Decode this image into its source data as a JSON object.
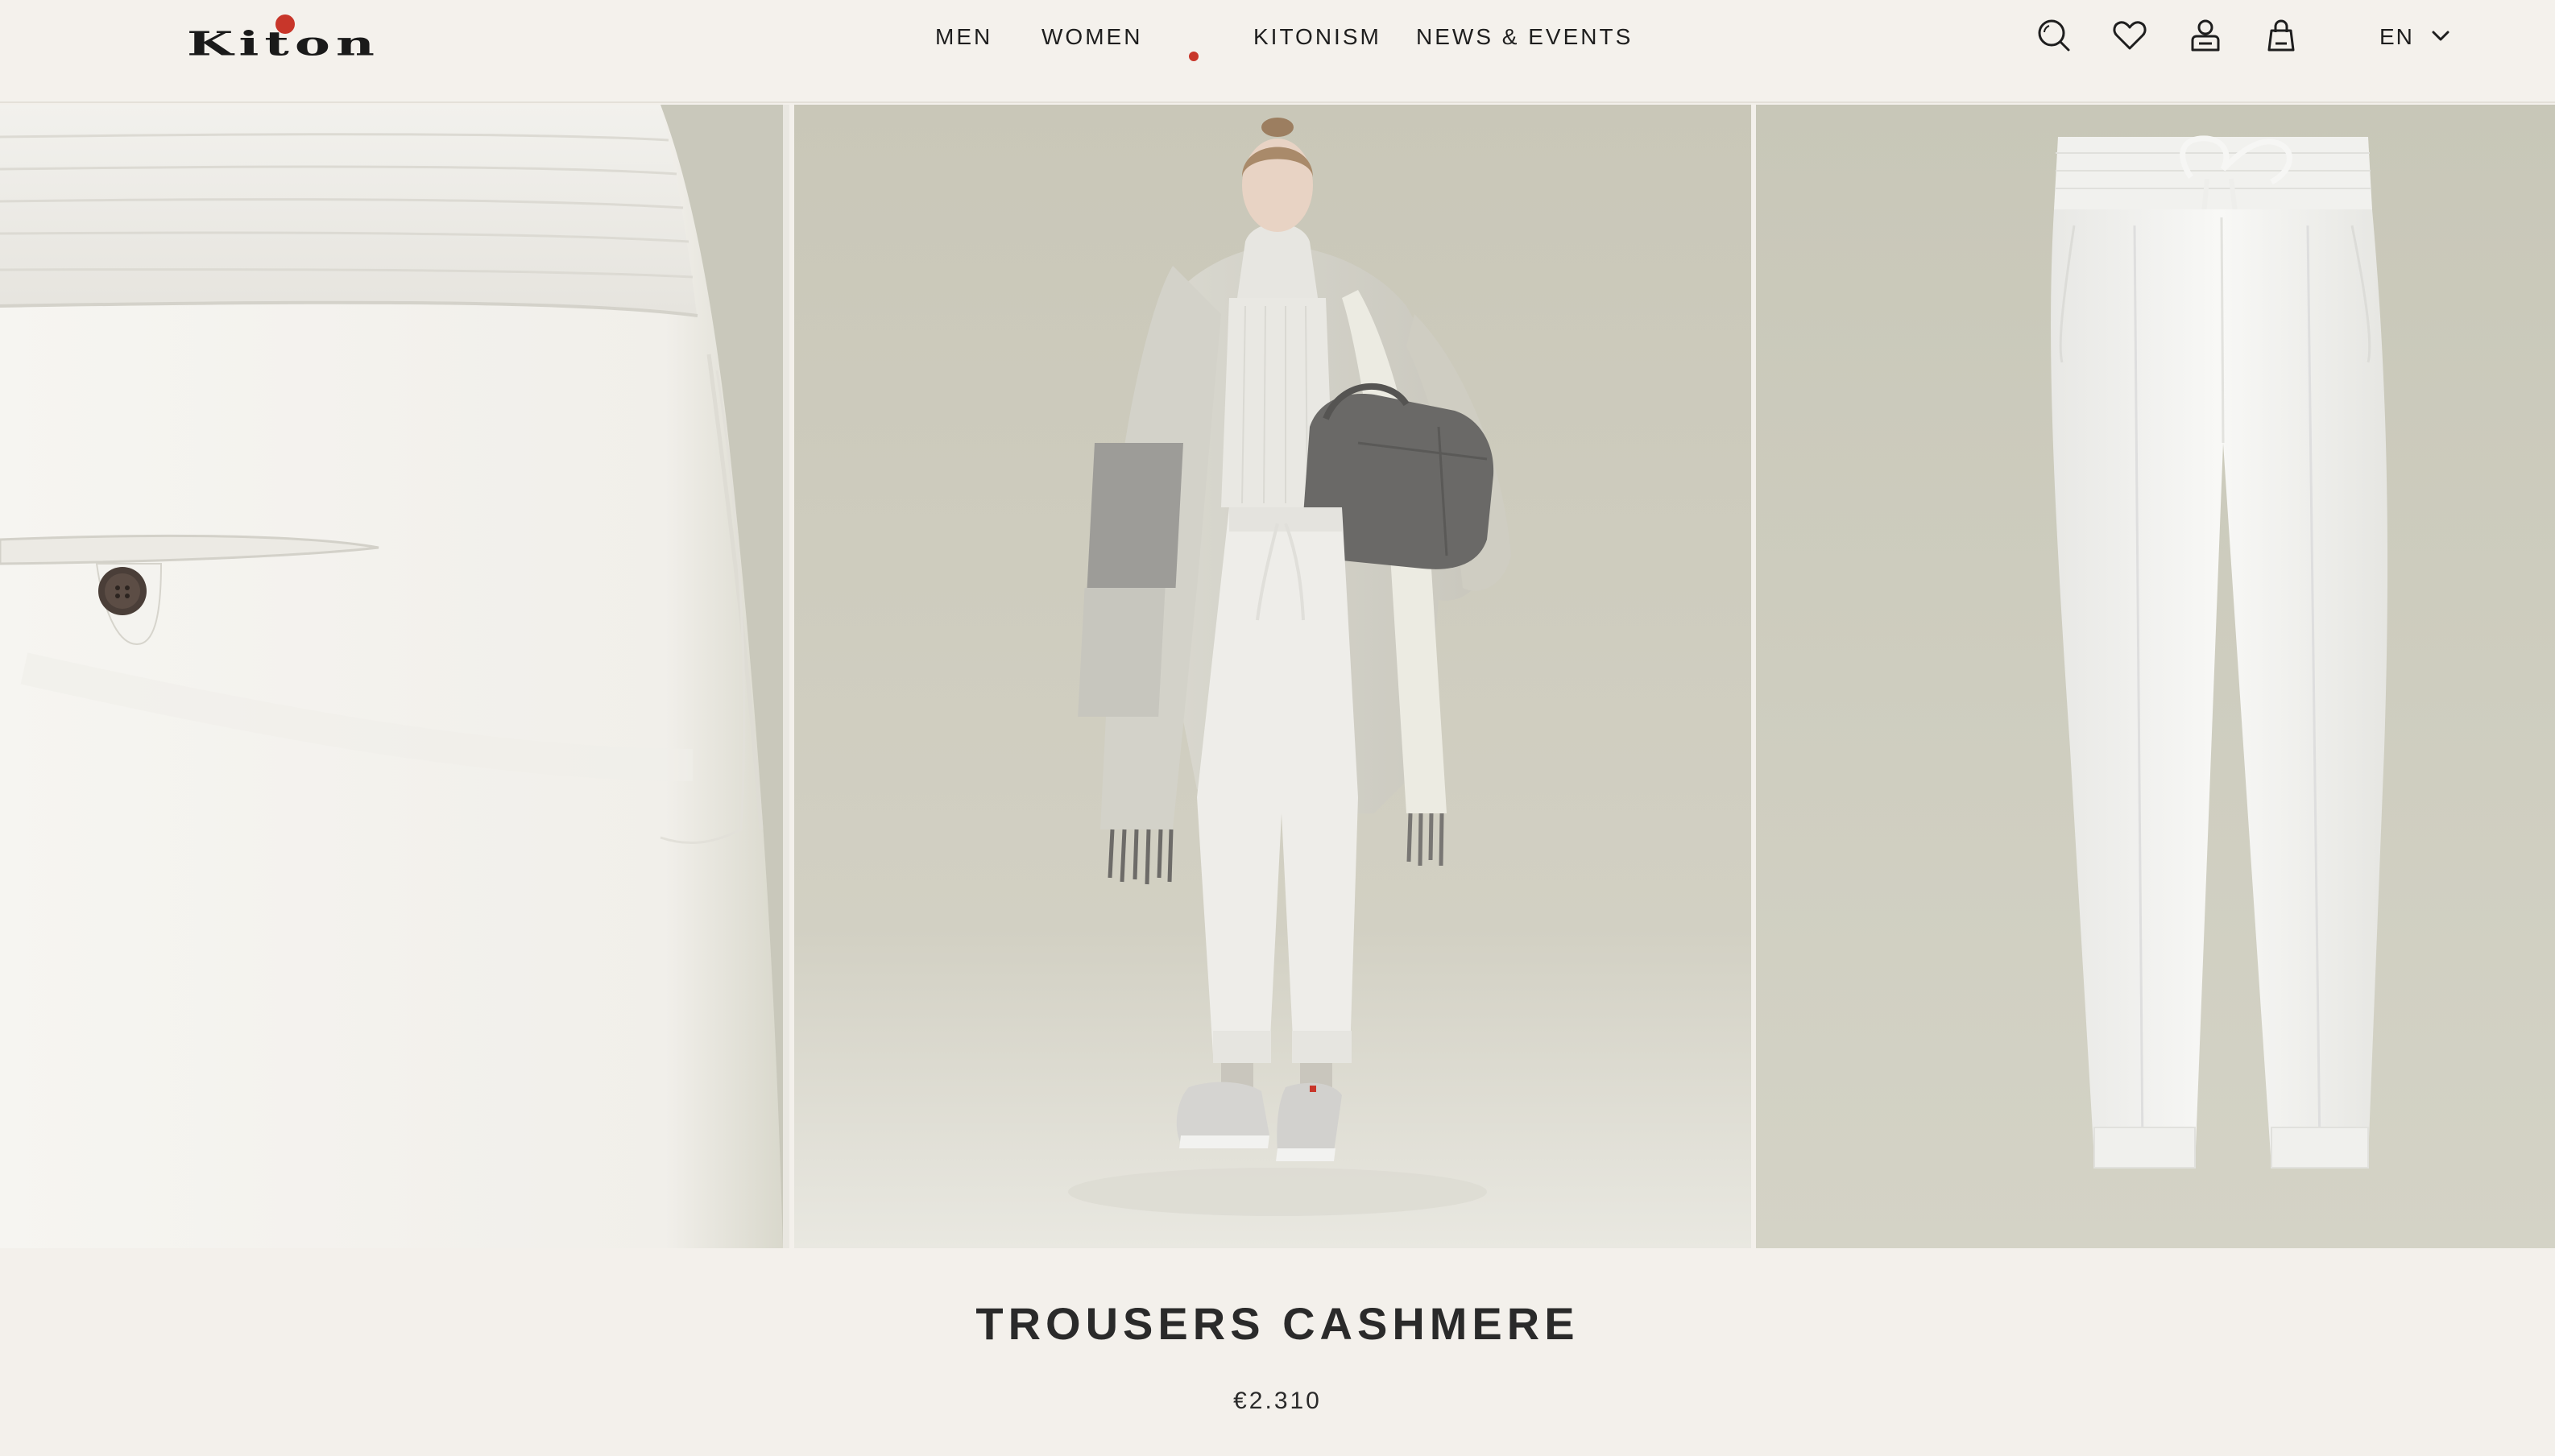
{
  "brand": {
    "name": "Kiton",
    "accent_color": "#c8362a"
  },
  "nav": {
    "items": [
      {
        "id": "men",
        "label": "MEN"
      },
      {
        "id": "women",
        "label": "WOMEN"
      },
      {
        "id": "kitonism",
        "label": "KITONISM"
      },
      {
        "id": "news",
        "label": "NEWS & EVENTS"
      }
    ]
  },
  "header_icons": [
    {
      "name": "search-icon"
    },
    {
      "name": "heart-icon"
    },
    {
      "name": "account-icon"
    },
    {
      "name": "shopping-bag-icon"
    }
  ],
  "language": {
    "current": "EN",
    "chevron": "chevron-down-icon"
  },
  "gallery": {
    "images": [
      {
        "name": "detail-back-pocket-image"
      },
      {
        "name": "model-full-look-image"
      },
      {
        "name": "product-flat-front-image"
      }
    ]
  },
  "product": {
    "title": "TROUSERS CASHMERE",
    "price": "€2.310"
  },
  "colors": {
    "background": "#f3f0eb",
    "photo_background": "#c9c7b9",
    "garment_white": "#f4f3ef"
  }
}
